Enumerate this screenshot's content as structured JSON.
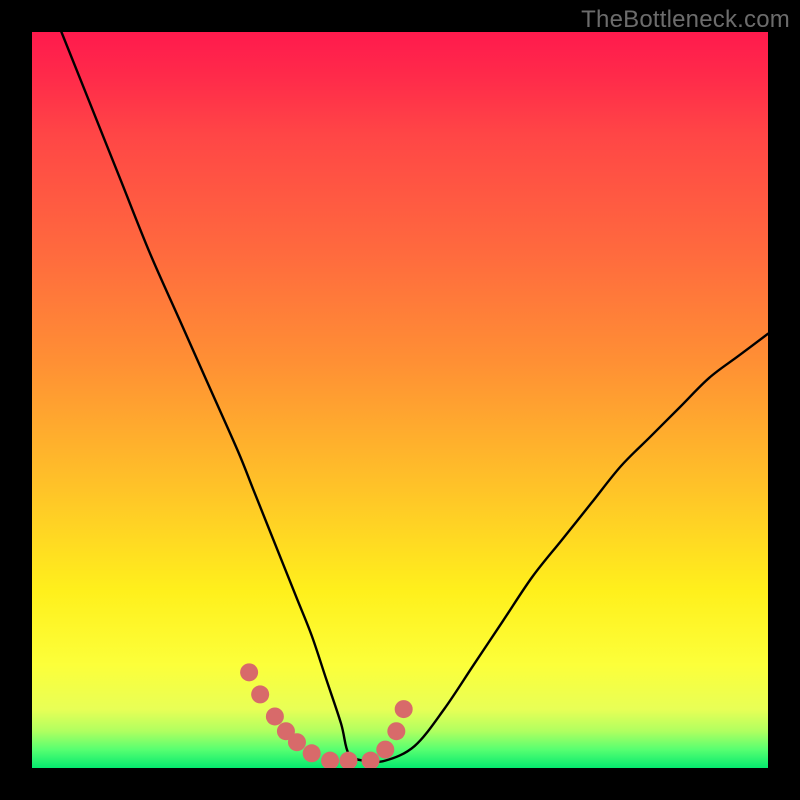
{
  "watermark": "TheBottleneck.com",
  "chart_data": {
    "type": "line",
    "title": "",
    "xlabel": "",
    "ylabel": "",
    "xlim": [
      0,
      100
    ],
    "ylim": [
      0,
      100
    ],
    "grid": false,
    "legend": false,
    "series": [
      {
        "name": "bottleneck-curve",
        "color": "#000000",
        "x": [
          4,
          8,
          12,
          16,
          20,
          24,
          28,
          30,
          32,
          34,
          36,
          38,
          40,
          42,
          43,
          45,
          48,
          52,
          56,
          60,
          64,
          68,
          72,
          76,
          80,
          84,
          88,
          92,
          96,
          100
        ],
        "y": [
          100,
          90,
          80,
          70,
          61,
          52,
          43,
          38,
          33,
          28,
          23,
          18,
          12,
          6,
          2,
          1,
          1,
          3,
          8,
          14,
          20,
          26,
          31,
          36,
          41,
          45,
          49,
          53,
          56,
          59
        ]
      },
      {
        "name": "highlight-dots",
        "color": "#d86a6a",
        "x": [
          29.5,
          31,
          33,
          34.5,
          36,
          38,
          40.5,
          43,
          46,
          48,
          49.5,
          50.5
        ],
        "y": [
          13,
          10,
          7,
          5,
          3.5,
          2,
          1,
          1,
          1,
          2.5,
          5,
          8
        ]
      }
    ],
    "colors": {
      "gradient_top": "#ff1a4d",
      "gradient_mid": "#fff01c",
      "gradient_bottom": "#05e96e",
      "curve": "#000000",
      "dots": "#d86a6a",
      "frame": "#000000"
    }
  }
}
